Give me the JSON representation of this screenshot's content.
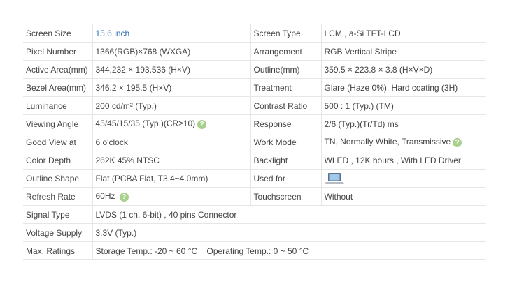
{
  "rows": [
    {
      "l1": "Screen Size",
      "v1": "15.6 inch",
      "l2": "Screen Type",
      "v2": "LCM ,   a-Si TFT-LCD"
    },
    {
      "l1": "Pixel Number",
      "v1": "1366(RGB)×768   (WXGA)",
      "l2": "Arrangement",
      "v2": "RGB Vertical Stripe"
    },
    {
      "l1": "Active Area(mm)",
      "v1": "344.232 × 193.536 (H×V)",
      "l2": "Outline(mm)",
      "v2": "359.5 × 223.8 × 3.8 (H×V×D)"
    },
    {
      "l1": "Bezel Area(mm)",
      "v1": "346.2 × 195.5 (H×V)",
      "l2": "Treatment",
      "v2": "Glare (Haze 0%), Hard coating (3H)"
    },
    {
      "l1": "Luminance",
      "v1": "200 cd/m² (Typ.)",
      "l2": "Contrast Ratio",
      "v2": "500 : 1 (Typ.) (TM)"
    },
    {
      "l1": "Viewing Angle",
      "v1": "45/45/15/35 (Typ.)(CR≥10)",
      "l2": "Response",
      "v2": "2/6 (Typ.)(Tr/Td) ms"
    },
    {
      "l1": "Good View at",
      "v1": "6 o'clock",
      "l2": "Work Mode",
      "v2": "TN, Normally White, Transmissive"
    },
    {
      "l1": "Color Depth",
      "v1": "262K   45% NTSC",
      "l2": "Backlight",
      "v2": "WLED , 12K hours , With LED Driver"
    },
    {
      "l1": "Outline Shape",
      "v1": "Flat (PCBA Flat, T3.4~4.0mm)",
      "l2": "Used for",
      "v2": ""
    },
    {
      "l1": "Refresh Rate",
      "v1": "60Hz",
      "l2": "Touchscreen",
      "v2": "Without"
    },
    {
      "l1": "Signal Type",
      "v1": "LVDS (1 ch, 6-bit) , 40 pins Connector"
    },
    {
      "l1": "Voltage Supply",
      "v1": "3.3V (Typ.)"
    },
    {
      "l1": "Max. Ratings",
      "v1": "Storage Temp.: -20 ~ 60 °C    Operating Temp.: 0 ~ 50 °C"
    }
  ],
  "icons": {
    "help": "question-mark-icon",
    "used_for": "laptop-icon",
    "help_glyph": "?",
    "help_color": "#a8d08d",
    "link_color": "#2f6fb3"
  }
}
